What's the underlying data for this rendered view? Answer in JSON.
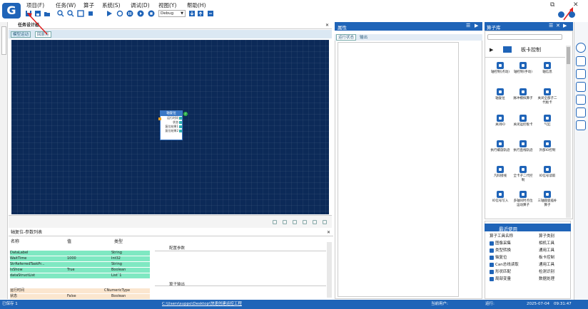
{
  "menu": [
    "项目(F)",
    "任务(W)",
    "算子",
    "系统(S)",
    "调试(D)",
    "视图(Y)",
    "帮助(H)"
  ],
  "toolbar": {
    "debug_select": "Debug"
  },
  "left_panel": {
    "title": "任务设计器",
    "tabs": [
      "模型运动",
      "回原点"
    ],
    "node": {
      "title": "轴复位",
      "rows": [
        "运行时间",
        "状态",
        "复位结果1",
        "复位结果2"
      ]
    }
  },
  "params": {
    "title": "轴复位-参数列表",
    "headers": [
      "名称",
      "值",
      "类型"
    ],
    "config_label": "配置参数",
    "output_label": "算子输出",
    "rows": [
      {
        "name": "DataLabel",
        "value": "",
        "type": "String"
      },
      {
        "name": "WaitTime",
        "value": "1000",
        "type": "Int32"
      },
      {
        "name": "StrReferredTaskPr...",
        "value": "",
        "type": "String"
      },
      {
        "name": "IsShow",
        "value": "True",
        "type": "Boolean"
      },
      {
        "name": "dataStructList",
        "value": "",
        "type": "List`1"
      }
    ],
    "out_rows": [
      {
        "name": "运行时间",
        "value": "",
        "type": "CNumericType"
      },
      {
        "name": "状态",
        "value": "False",
        "type": "Boolean"
      }
    ]
  },
  "properties": {
    "title": "属性",
    "tabs": [
      "运行状态",
      "输出"
    ]
  },
  "operators": {
    "title": "算子库",
    "category": "板卡控制",
    "items": [
      "轴控制(点动)",
      "轴控制(手动)",
      "轴信息",
      "轴复位",
      "脉冲模拟算子",
      "关闭全部子二代板卡",
      "关闭IO",
      "关闭运控板卡",
      "气缸",
      "执行螺旋轨迹",
      "执行直线轨迹",
      "外部IO控制",
      "凡科接线",
      "全卡子二代控制",
      "IO信号读取",
      "IO信号写入",
      "多轴同时点位运动算子",
      "三轴圆弧插补算子"
    ]
  },
  "recent": {
    "title": "最近使用",
    "headers": [
      "算子工具名称",
      "算子类别"
    ],
    "rows": [
      {
        "name": "图像采集",
        "cat": "相机工具"
      },
      {
        "name": "类型转换",
        "cat": "通用工具"
      },
      {
        "name": "轴复位",
        "cat": "板卡控制"
      },
      {
        "name": "Can总线读取",
        "cat": "通用工具"
      },
      {
        "name": "形状匹配",
        "cat": "检测识别"
      },
      {
        "name": "局部变量",
        "cat": "数据处理"
      }
    ]
  },
  "status": {
    "save": "已保存 1",
    "path": "C:\\Users\\suppo\\Desktop\\快速创建运控工程",
    "user": "当前用户:",
    "run": "运行:",
    "date": "2025-07-04",
    "time": "09:31:47"
  }
}
